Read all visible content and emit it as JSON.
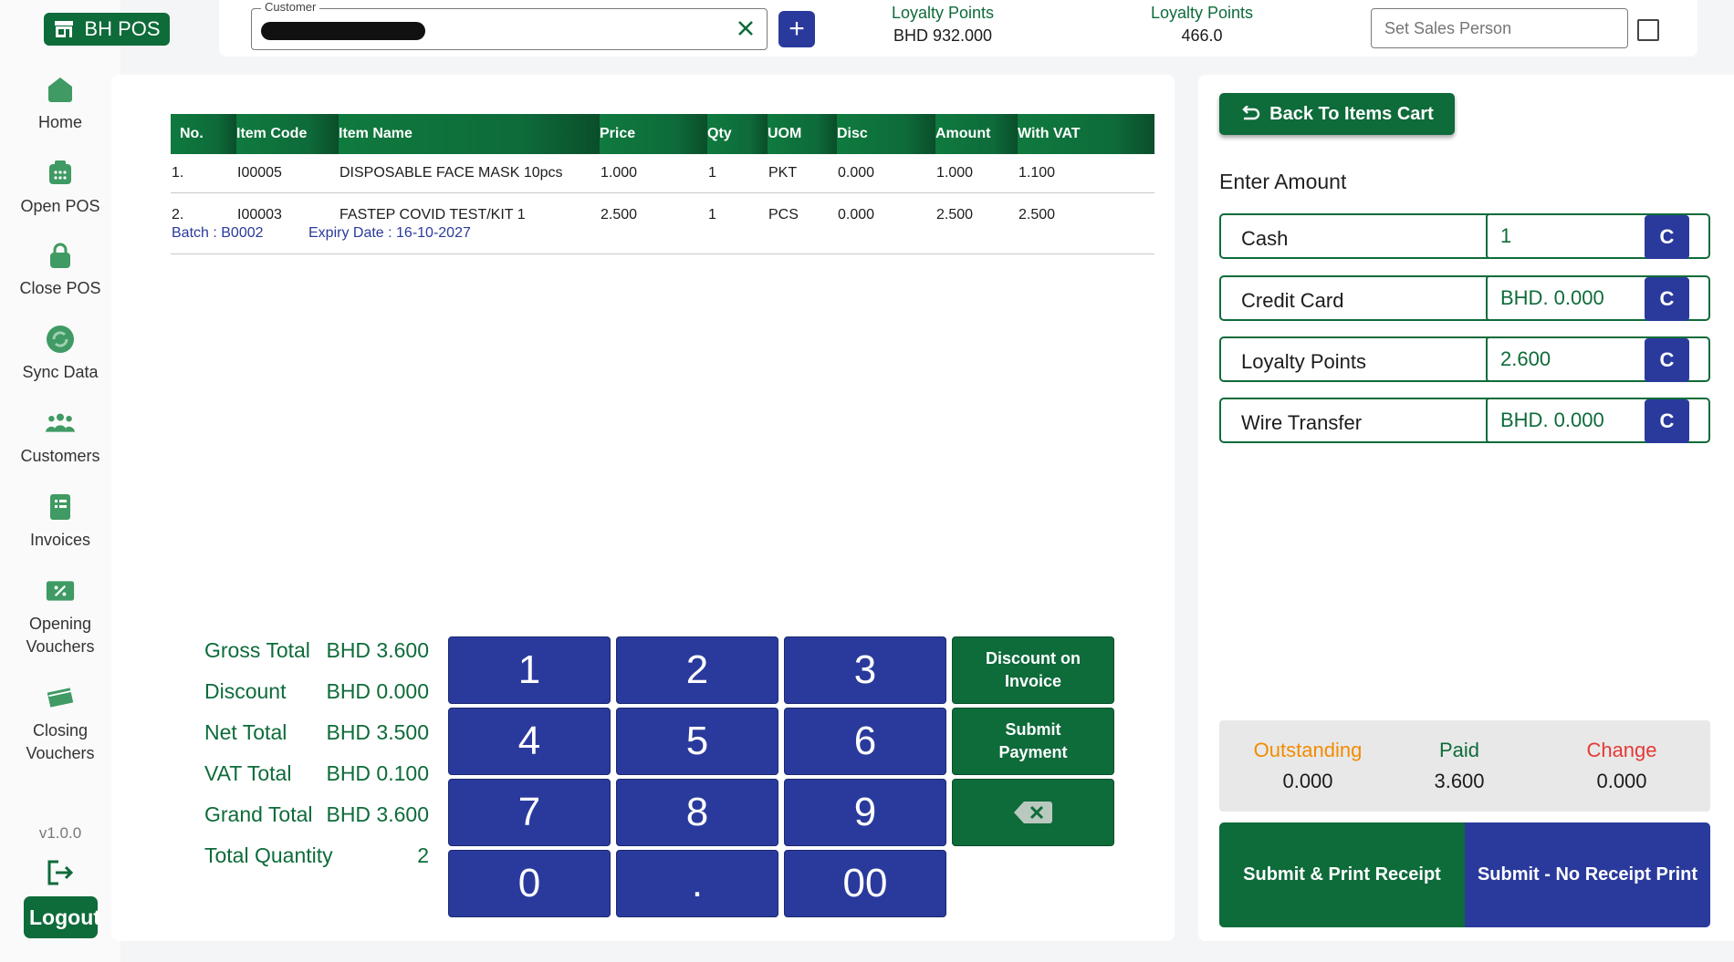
{
  "brand": {
    "name": "BH POS"
  },
  "sidebar": {
    "items": [
      {
        "label": "Home",
        "icon": "home-icon"
      },
      {
        "label": "Open POS",
        "icon": "register-icon"
      },
      {
        "label": "Close POS",
        "icon": "lock-icon"
      },
      {
        "label": "Sync Data",
        "icon": "sync-icon"
      },
      {
        "label": "Customers",
        "icon": "people-icon"
      },
      {
        "label": "Invoices",
        "icon": "invoice-icon"
      },
      {
        "label": "Opening Vouchers",
        "label_line1": "Opening",
        "label_line2": "Vouchers",
        "icon": "percent-ticket-icon"
      },
      {
        "label": "Closing Vouchers",
        "label_line1": "Closing",
        "label_line2": "Vouchers",
        "icon": "ticket-icon"
      }
    ],
    "version": "v1.0.0",
    "logout_label": "Logout"
  },
  "topbar": {
    "customer_label": "Customer",
    "customer_value": "",
    "loyalty_points_amount": {
      "title": "Loyalty Points",
      "value": "BHD  932.000"
    },
    "loyalty_points_count": {
      "title": "Loyalty Points",
      "value": "466.0"
    },
    "sales_person_placeholder": "Set Sales Person"
  },
  "cart": {
    "columns": [
      "No.",
      "Item Code",
      "Item Name",
      "Price",
      "Qty",
      "UOM",
      "Disc",
      "Amount",
      "With VAT"
    ],
    "rows": [
      {
        "no": "1.",
        "code": "I00005",
        "name": "DISPOSABLE FACE MASK 10pcs",
        "price": "1.000",
        "qty": "1",
        "uom": "PKT",
        "disc": "0.000",
        "amount": "1.000",
        "with_vat": "1.100"
      },
      {
        "no": "2.",
        "code": "I00003",
        "name": "FASTEP COVID TEST/KIT 1",
        "price": "2.500",
        "qty": "1",
        "uom": "PCS",
        "disc": "0.000",
        "amount": "2.500",
        "with_vat": "2.500",
        "batch": "Batch : B0002",
        "expiry": "Expiry Date : 16-10-2027"
      }
    ]
  },
  "summary": {
    "gross_total": {
      "label": "Gross Total",
      "value": "BHD 3.600"
    },
    "discount": {
      "label": "Discount",
      "value": "BHD 0.000"
    },
    "net_total": {
      "label": "Net Total",
      "value": "BHD 3.500"
    },
    "vat_total": {
      "label": "VAT Total",
      "value": "BHD 0.100"
    },
    "grand_total": {
      "label": "Grand Total",
      "value": "BHD 3.600"
    },
    "total_quantity": {
      "label": "Total Quantity",
      "value": "2"
    }
  },
  "keypad": {
    "keys": [
      "1",
      "2",
      "3",
      "4",
      "5",
      "6",
      "7",
      "8",
      "9",
      "0",
      ".",
      "00"
    ],
    "discount_on_invoice_line1": "Discount on",
    "discount_on_invoice_line2": "Invoice",
    "submit_payment_line1": "Submit",
    "submit_payment_line2": "Payment"
  },
  "payment": {
    "back_label": "Back To Items Cart",
    "enter_amount": "Enter Amount",
    "methods": [
      {
        "label": "Cash",
        "value": "1",
        "clear": "C"
      },
      {
        "label": "Credit Card",
        "value": "BHD. 0.000",
        "clear": "C"
      },
      {
        "label": "Loyalty Points",
        "value": "2.600",
        "clear": "C"
      },
      {
        "label": "Wire Transfer",
        "value": "BHD. 0.000",
        "clear": "C"
      }
    ],
    "outstanding": {
      "label": "Outstanding",
      "value": "0.000",
      "color": "#f28c00"
    },
    "paid": {
      "label": "Paid",
      "value": "3.600",
      "color": "#0e6b3a"
    },
    "change": {
      "label": "Change",
      "value": "0.000",
      "color": "#e53935"
    },
    "submit_print_label": "Submit & Print Receipt",
    "submit_no_print_label": "Submit - No Receipt Print"
  },
  "colors": {
    "primary_green": "#0e6b3a",
    "primary_blue": "#2a3a9c"
  }
}
